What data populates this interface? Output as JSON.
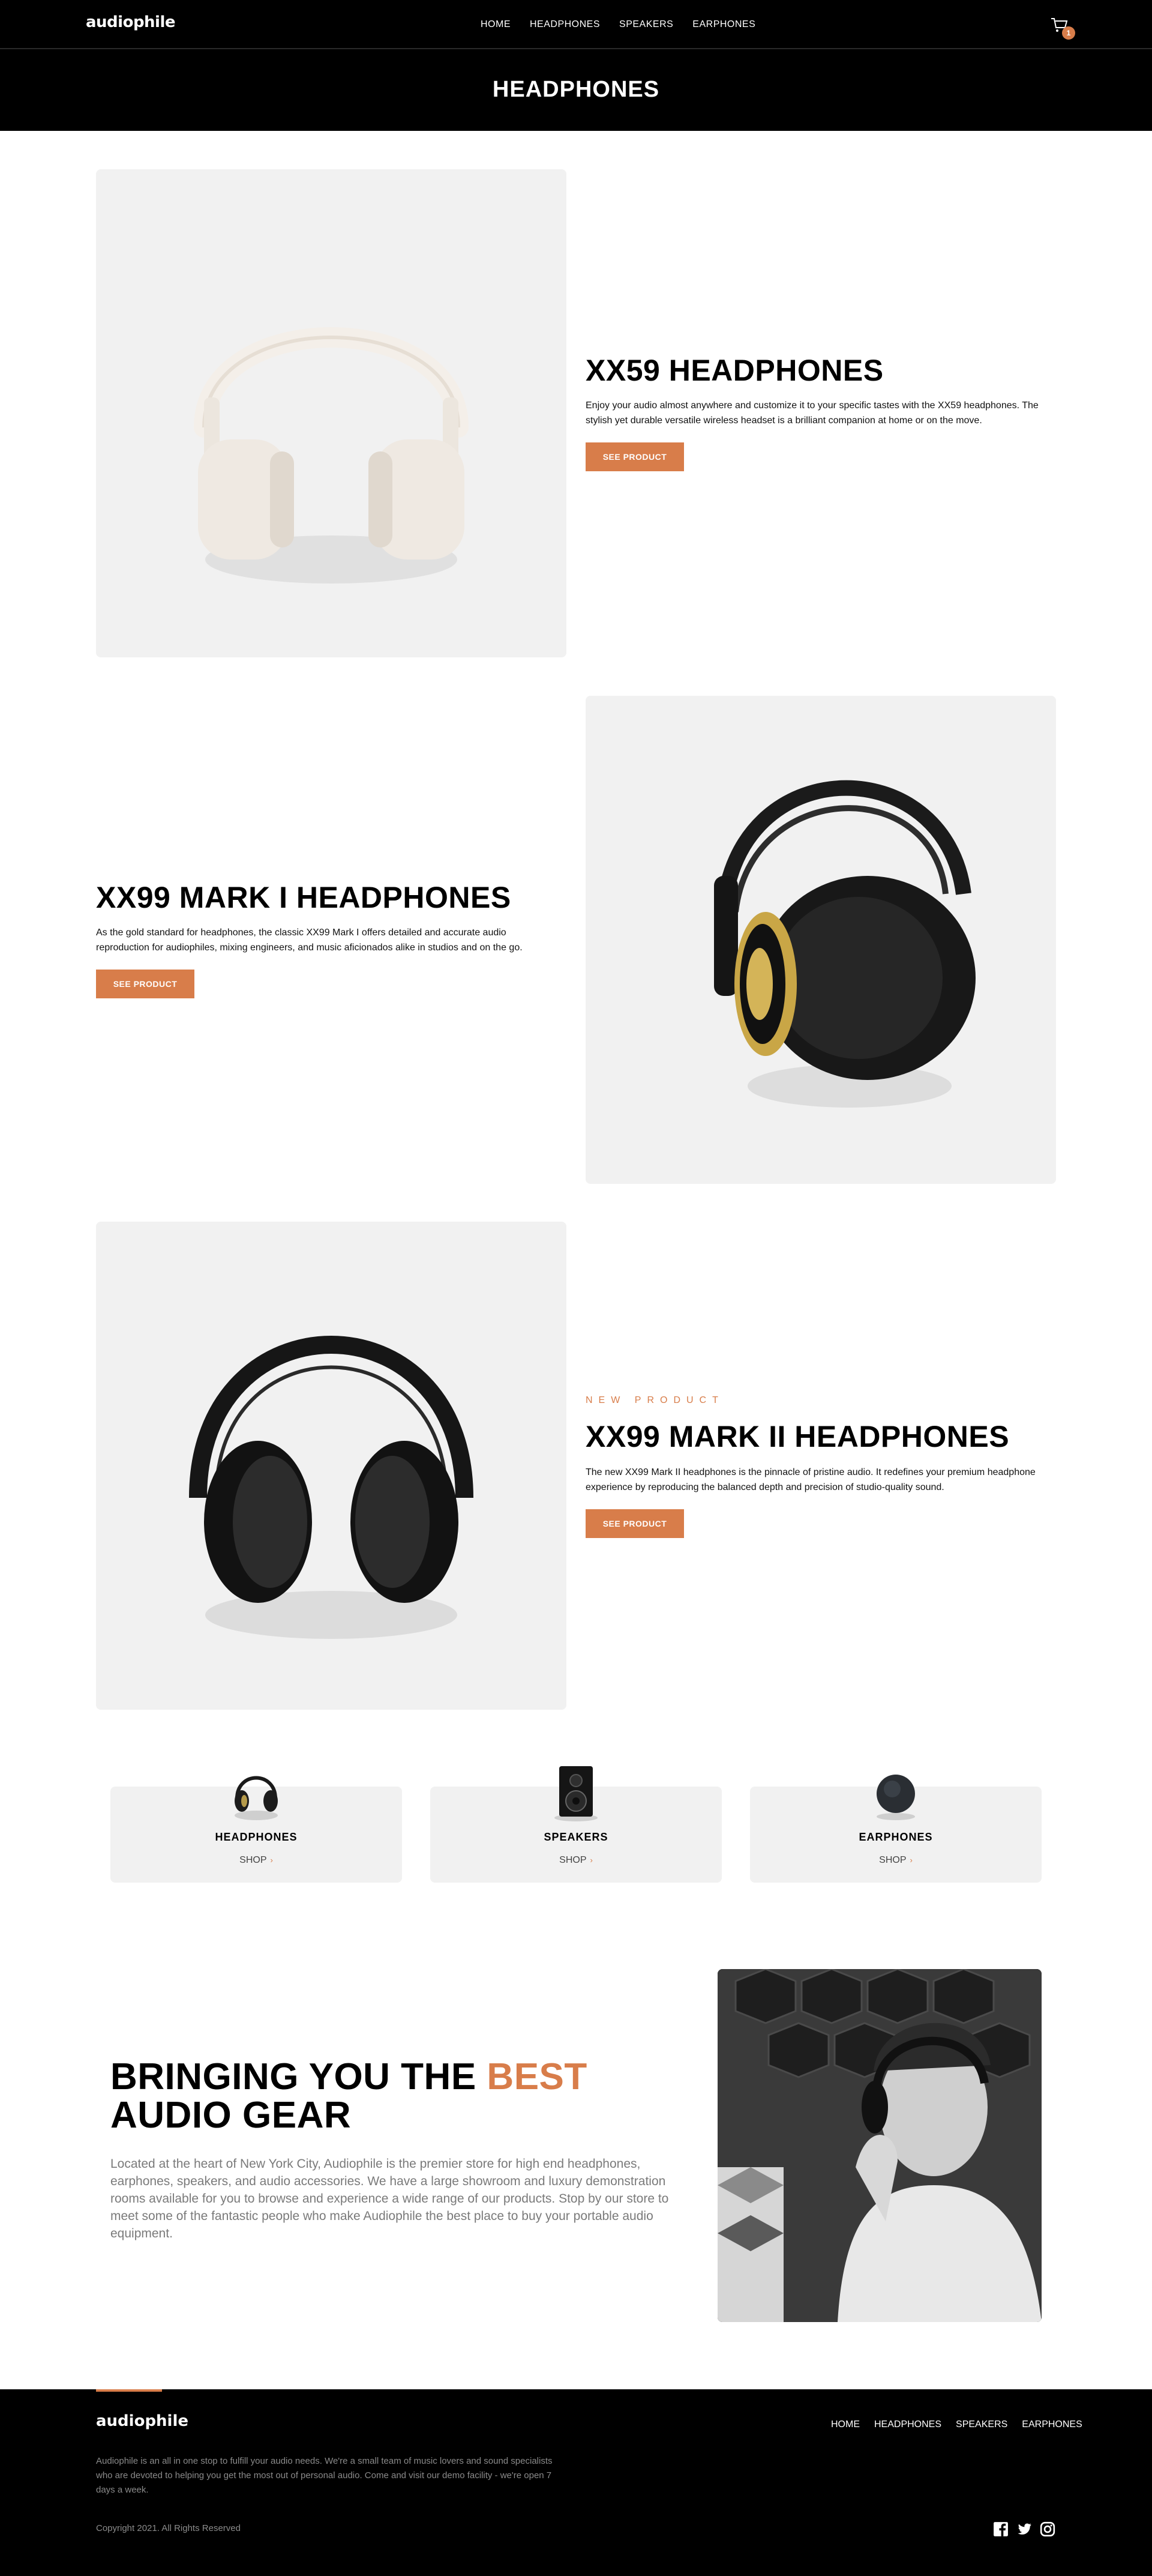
{
  "brand": {
    "name": "audiophile"
  },
  "nav": [
    "HOME",
    "HEADPHONES",
    "SPEAKERS",
    "EARPHONES"
  ],
  "cart": {
    "count": "1",
    "icon": "cart-icon"
  },
  "page_title": "HEADPHONES",
  "products": [
    {
      "title": "XX59 HEADPHONES",
      "description": "Enjoy your audio almost anywhere and customize it to your specific tastes with the XX59 headphones. The stylish yet durable versatile wireless headset is a brilliant companion at home or on the move.",
      "button": "SEE PRODUCT"
    },
    {
      "title": "XX99 MARK I HEADPHONES",
      "description": "As the gold standard for headphones, the classic XX99 Mark I offers detailed and accurate audio reproduction for audiophiles, mixing engineers, and music aficionados alike in studios and on the go.",
      "button": "SEE PRODUCT"
    },
    {
      "overline": "NEW PRODUCT",
      "title": "XX99 MARK II HEADPHONES",
      "description": "The new XX99 Mark II headphones is the pinnacle of pristine audio. It redefines your premium headphone experience by reproducing the balanced depth and precision of studio-quality sound.",
      "button": "SEE PRODUCT"
    }
  ],
  "categories": [
    {
      "title": "HEADPHONES",
      "shop": "SHOP",
      "chevron": "›"
    },
    {
      "title": "SPEAKERS",
      "shop": "SHOP",
      "chevron": "›"
    },
    {
      "title": "EARPHONES",
      "shop": "SHOP",
      "chevron": "›"
    }
  ],
  "about": {
    "heading_before": "BRINGING YOU THE ",
    "heading_accent": "BEST",
    "heading_after": " AUDIO GEAR",
    "text": "Located at the heart of New York City, Audiophile is the premier store for high end headphones, earphones, speakers, and audio accessories. We have a large showroom and luxury demonstration rooms available for you to browse and experience a wide range of our products. Stop by our store to meet some of the fantastic people who make Audiophile the best place to buy your portable audio equipment."
  },
  "footer": {
    "logo": "audiophile",
    "nav": [
      "HOME",
      "HEADPHONES",
      "SPEAKERS",
      "EARPHONES"
    ],
    "description": "Audiophile is an all in one stop to fulfill your audio needs. We're a small team of music lovers and sound specialists who are devoted to helping you get the most out of personal audio. Come and visit our demo facility - we're open 7 days a week.",
    "copyright": "Copyright 2021. All Rights Reserved",
    "social": [
      "facebook-icon",
      "twitter-icon",
      "instagram-icon"
    ]
  },
  "colors": {
    "accent": "#d87d4a",
    "dark": "#000000",
    "panel": "#f1f1f1"
  }
}
